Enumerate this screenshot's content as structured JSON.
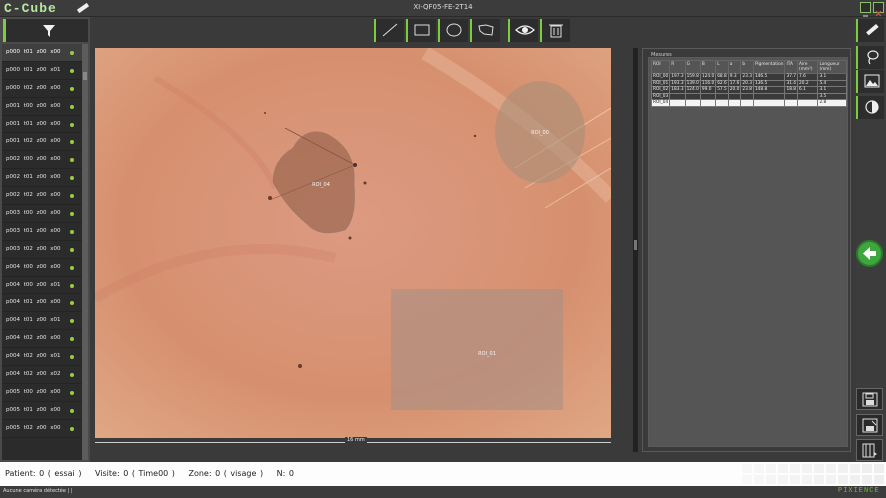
{
  "app": {
    "logo": "C-Cube",
    "window_title": "XI-QF05-FE-2T14",
    "brand": "PIXIENCE"
  },
  "file_list": [
    "p000 t01 z00 x00",
    "p000 t01 z00 x01",
    "p000 t02 z00 x00",
    "p001 t00 z00 x00",
    "p001 t01 z00 x00",
    "p001 t02 z00 x00",
    "p002 t00 z00 x00",
    "p002 t01 z00 x00",
    "p002 t02 z00 x00",
    "p003 t00 z00 x00",
    "p003 t01 z00 x00",
    "p003 t02 z00 x00",
    "p004 t00 z00 x00",
    "p004 t00 z00 x01",
    "p004 t01 z00 x00",
    "p004 t01 z00 x01",
    "p004 t02 z00 x00",
    "p004 t02 z00 x01",
    "p004 t02 z00 x02",
    "p005 t00 z00 x00",
    "p005 t01 z00 x00",
    "p005 t02 z00 x00"
  ],
  "rois": [
    {
      "label": "ROI_00"
    },
    {
      "label": "ROI_01"
    },
    {
      "label": "ROI_04"
    }
  ],
  "scale_label": "16 mm",
  "measures": {
    "title": "Mesures",
    "columns": [
      "ROI",
      "R",
      "G",
      "B",
      "L",
      "a",
      "b",
      "Pigmentation",
      "ITA",
      "Aire (mm²)",
      "Longueur (mm)"
    ],
    "rows": [
      [
        "ROI_00",
        "197.3",
        "159.8",
        "124.0",
        "68.8",
        "9.3",
        "23.3",
        "146.5",
        "37.7",
        "7.6",
        "3.1"
      ],
      [
        "ROI_01",
        "193.3",
        "139.0",
        "116.0",
        "62.6",
        "17.6",
        "20.3",
        "136.5",
        "31.4",
        "20.2",
        "5.4"
      ],
      [
        "ROI_02",
        "183.3",
        "124.0",
        "99.0",
        "57.5",
        "20.0",
        "23.8",
        "148.8",
        "18.8",
        "6.1",
        "3.1"
      ],
      [
        "ROI_03",
        "",
        "",
        "",
        "",
        "",
        "",
        "",
        "",
        "",
        "3.5"
      ],
      [
        "ROI_04",
        "",
        "",
        "",
        "",
        "",
        "",
        "",
        "",
        "",
        "2.8"
      ]
    ]
  },
  "status": {
    "patient": "Patient: 0 ( essai )",
    "visit": "Visite: 0 ( Time00 )",
    "zone": "Zone: 0 ( visage )",
    "n": "N: 0"
  },
  "footer": "Aucune caméra détectée  |   |",
  "colors": {
    "accent": "#7ccd3c",
    "back_button": "#3fa63f"
  }
}
